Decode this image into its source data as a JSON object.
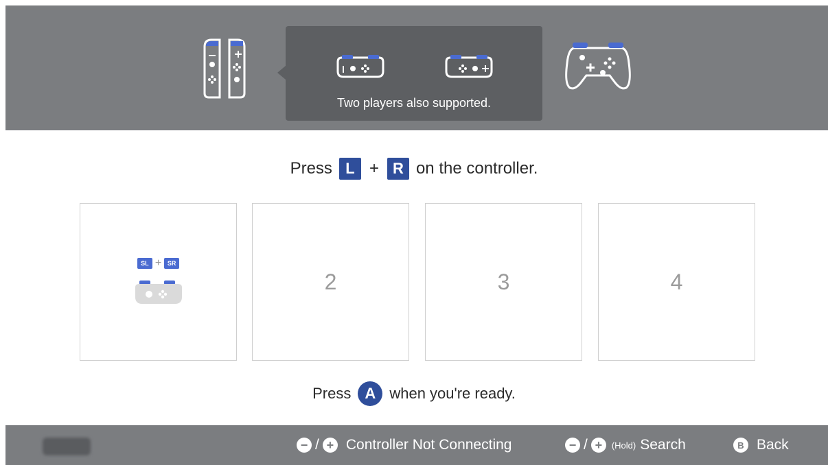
{
  "header": {
    "tooltip_text": "Two players also supported."
  },
  "instruction": {
    "prefix": "Press",
    "key_left": "L",
    "plus": "+",
    "key_right": "R",
    "suffix": "on the controller."
  },
  "slots": [
    {
      "number": "",
      "hint_left": "SL",
      "hint_plus": "+",
      "hint_right": "SR"
    },
    {
      "number": "2"
    },
    {
      "number": "3"
    },
    {
      "number": "4"
    }
  ],
  "ready": {
    "prefix": "Press",
    "button": "A",
    "suffix": "when you're ready."
  },
  "footer": {
    "minus_symbol": "−",
    "plus_symbol": "+",
    "slash": "/",
    "not_connecting_label": "Controller Not Connecting",
    "hold_label": "(Hold)",
    "search_label": "Search",
    "back_button": "B",
    "back_label": "Back"
  },
  "colors": {
    "accent_blue": "#2f4e9b",
    "bar_gray": "#7b7d80",
    "tooltip_gray": "#5d5f62",
    "slot_border": "#cfcfcf"
  },
  "icons": {
    "joycon_pair": "joycon-pair-icon",
    "joycon_left_sideways": "joycon-left-sideways-icon",
    "joycon_right_sideways": "joycon-right-sideways-icon",
    "pro_controller": "pro-controller-icon",
    "slot_controller": "joycon-sideways-icon"
  }
}
